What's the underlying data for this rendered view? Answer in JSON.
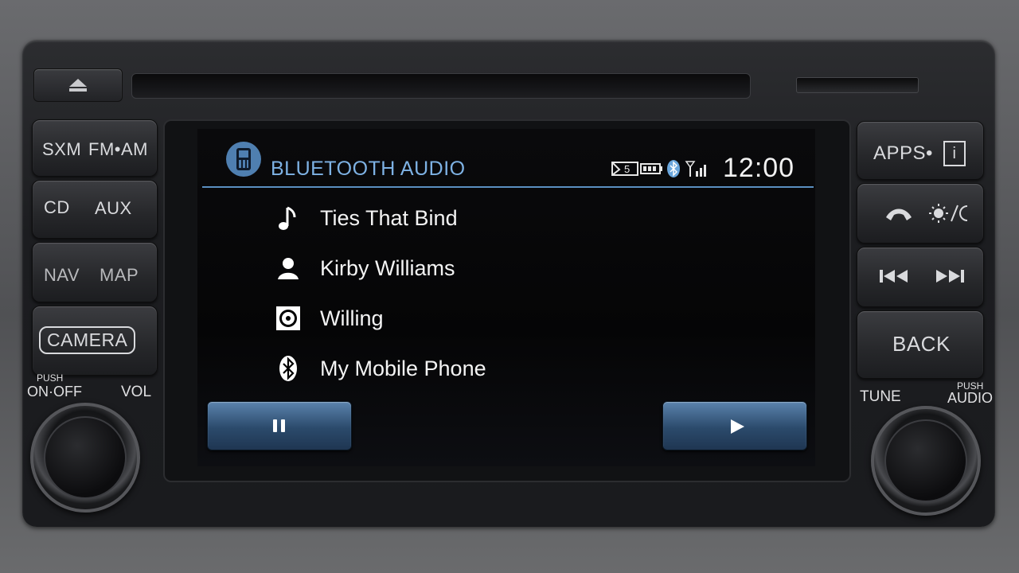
{
  "head_unit": {
    "left_buttons": {
      "sxm": "SXM",
      "fm_am": "FM•AM",
      "cd": "CD",
      "aux": "AUX",
      "nav": "NAV",
      "map": "MAP",
      "camera": "CAMERA"
    },
    "left_labels": {
      "push": "PUSH",
      "on_off": "ON·OFF",
      "vol": "VOL"
    },
    "right_buttons": {
      "apps": "APPS•",
      "info": "i",
      "back": "BACK"
    },
    "right_labels": {
      "tune": "TUNE",
      "push": "PUSH",
      "audio": "AUDIO"
    }
  },
  "screen": {
    "title": "BLUETOOTH AUDIO",
    "clock": "12:00",
    "status": {
      "message_count": "5"
    },
    "tracks": [
      {
        "icon": "music-note-icon",
        "text": "Ties That Bind"
      },
      {
        "icon": "person-icon",
        "text": "Kirby Williams"
      },
      {
        "icon": "album-icon",
        "text": "Willing"
      },
      {
        "icon": "bluetooth-icon",
        "text": "My Mobile Phone"
      }
    ]
  },
  "colors": {
    "header_text": "#7eb2e4",
    "accent_blue": "#4f7fb0",
    "button_blue": "#2b4a6b"
  }
}
